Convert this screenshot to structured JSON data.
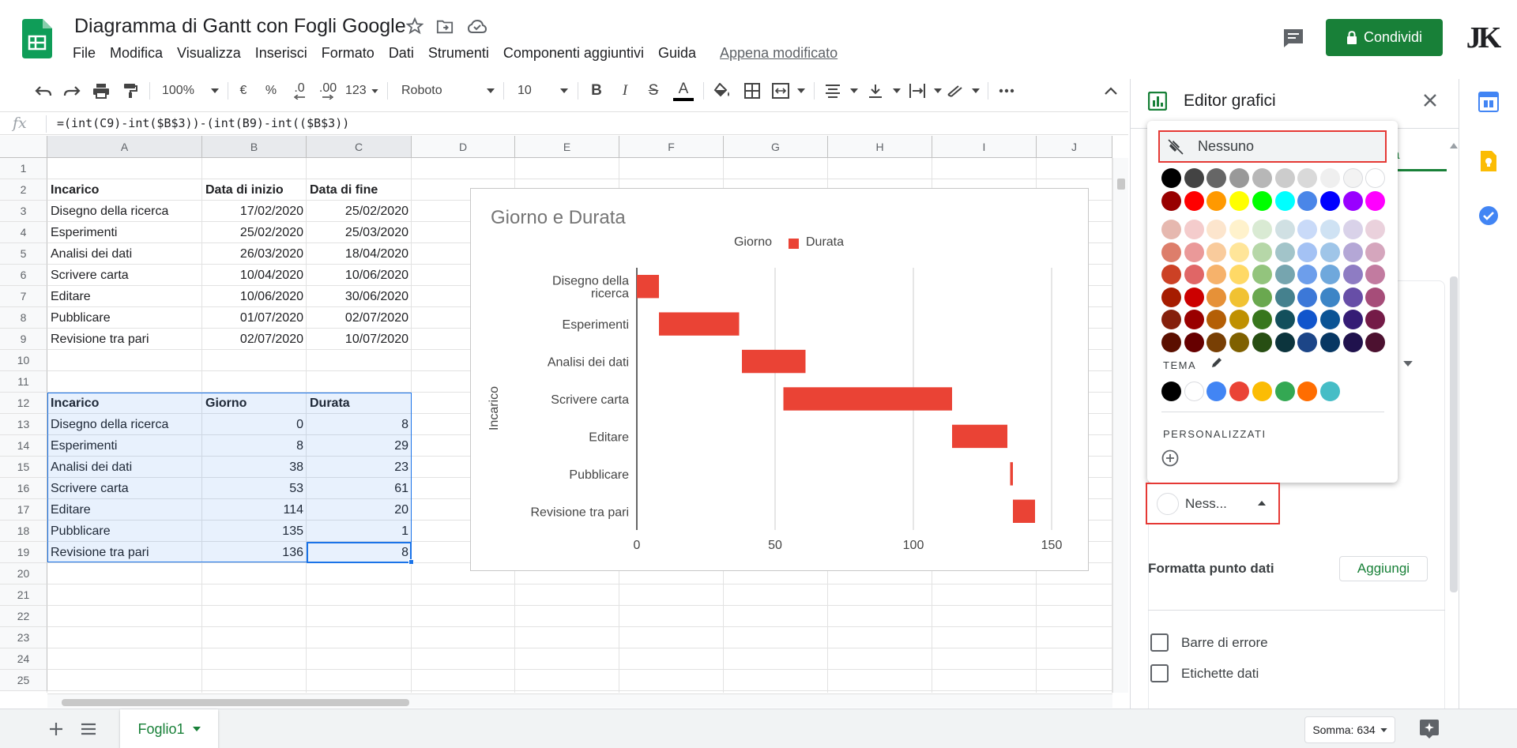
{
  "header": {
    "doc_title": "Diagramma di Gantt con Fogli Google",
    "menu": [
      "File",
      "Modifica",
      "Visualizza",
      "Inserisci",
      "Formato",
      "Dati",
      "Strumenti",
      "Componenti aggiuntivi",
      "Guida"
    ],
    "last_edit": "Appena modificato",
    "share_label": "Condividi",
    "avatar_label": "JK"
  },
  "toolbar": {
    "zoom": "100%",
    "currency": "€",
    "percent": "%",
    "dec_less": ".0",
    "dec_more": ".00",
    "format_more": "123",
    "font": "Roboto",
    "font_size": "10",
    "bold": "B",
    "italic": "I",
    "strike": "S",
    "textcolor": "A"
  },
  "formula_bar": {
    "fx": "fx",
    "formula": "=(int(C9)-int($B$3))-(int(B9)-int(($B$3))"
  },
  "grid": {
    "columns": [
      "A",
      "B",
      "C",
      "D",
      "E",
      "F",
      "G",
      "H",
      "I",
      "J"
    ],
    "rows": [
      "1",
      "2",
      "3",
      "4",
      "5",
      "6",
      "7",
      "8",
      "9",
      "10",
      "11",
      "12",
      "13",
      "14",
      "15",
      "16",
      "17",
      "18",
      "19",
      "20",
      "21",
      "22",
      "23",
      "24",
      "25"
    ],
    "table1": {
      "headers": [
        "Incarico",
        "Data di inizio",
        "Data di fine"
      ],
      "rows": [
        [
          "Disegno della ricerca",
          "17/02/2020",
          "25/02/2020"
        ],
        [
          "Esperimenti",
          "25/02/2020",
          "25/03/2020"
        ],
        [
          "Analisi dei dati",
          "26/03/2020",
          "18/04/2020"
        ],
        [
          "Scrivere carta",
          "10/04/2020",
          "10/06/2020"
        ],
        [
          "Editare",
          "10/06/2020",
          "30/06/2020"
        ],
        [
          "Pubblicare",
          "01/07/2020",
          "02/07/2020"
        ],
        [
          "Revisione tra pari",
          "02/07/2020",
          "10/07/2020"
        ]
      ]
    },
    "table2": {
      "headers": [
        "Incarico",
        "Giorno",
        "Durata"
      ],
      "rows": [
        [
          "Disegno della ricerca",
          "0",
          "8"
        ],
        [
          "Esperimenti",
          "8",
          "29"
        ],
        [
          "Analisi dei dati",
          "38",
          "23"
        ],
        [
          "Scrivere carta",
          "53",
          "61"
        ],
        [
          "Editare",
          "114",
          "20"
        ],
        [
          "Pubblicare",
          "135",
          "1"
        ],
        [
          "Revisione tra pari",
          "136",
          "8"
        ]
      ]
    }
  },
  "chart_data": {
    "type": "bar",
    "orientation": "horizontal",
    "stacked": true,
    "title": "Giorno e Durata",
    "ylabel": "Incarico",
    "categories": [
      "Disegno della ricerca",
      "Esperimenti",
      "Analisi dei dati",
      "Scrivere carta",
      "Editare",
      "Pubblicare",
      "Revisione tra pari"
    ],
    "category_lines": [
      [
        "Disegno della",
        "ricerca"
      ],
      [
        "Esperimenti"
      ],
      [
        "Analisi dei dati"
      ],
      [
        "Scrivere carta"
      ],
      [
        "Editare"
      ],
      [
        "Pubblicare"
      ],
      [
        "Revisione tra pari"
      ]
    ],
    "series": [
      {
        "name": "Giorno",
        "values": [
          0,
          8,
          38,
          53,
          114,
          135,
          136
        ],
        "color": "transparent"
      },
      {
        "name": "Durata",
        "values": [
          8,
          29,
          23,
          61,
          20,
          1,
          8
        ],
        "color": "#ea4335"
      }
    ],
    "xlim": [
      0,
      160
    ],
    "xticks": [
      0,
      50,
      100,
      150
    ],
    "grid": true,
    "legend": "top"
  },
  "panel": {
    "title": "Editor grafici",
    "tab_fragment": "zza",
    "color_picker": {
      "none_label": "Nessuno",
      "grayscale": [
        "#000000",
        "#434343",
        "#666666",
        "#999999",
        "#b7b7b7",
        "#cccccc",
        "#d9d9d9",
        "#efefef",
        "#f3f3f3",
        "#ffffff"
      ],
      "brights": [
        "#980000",
        "#ff0000",
        "#ff9900",
        "#ffff00",
        "#00ff00",
        "#00ffff",
        "#4a86e8",
        "#0000ff",
        "#9900ff",
        "#ff00ff"
      ],
      "shades": [
        [
          "#e6b8af",
          "#f4cccc",
          "#fce5cd",
          "#fff2cc",
          "#d9ead3",
          "#d0e0e3",
          "#c9daf8",
          "#cfe2f3",
          "#d9d2e9",
          "#ead1dc"
        ],
        [
          "#dd7e6b",
          "#ea9999",
          "#f9cb9c",
          "#ffe599",
          "#b6d7a8",
          "#a2c4c9",
          "#a4c2f4",
          "#9fc5e8",
          "#b4a7d6",
          "#d5a6bd"
        ],
        [
          "#cc4125",
          "#e06666",
          "#f6b26b",
          "#ffd966",
          "#93c47d",
          "#76a5af",
          "#6d9eeb",
          "#6fa8dc",
          "#8e7cc3",
          "#c27ba0"
        ],
        [
          "#a61c00",
          "#cc0000",
          "#e69138",
          "#f1c232",
          "#6aa84f",
          "#45818e",
          "#3c78d8",
          "#3d85c6",
          "#674ea7",
          "#a64d79"
        ],
        [
          "#85200c",
          "#990000",
          "#b45f06",
          "#bf9000",
          "#38761d",
          "#134f5c",
          "#1155cc",
          "#0b5394",
          "#351c75",
          "#741b47"
        ],
        [
          "#5b0f00",
          "#660000",
          "#783f04",
          "#7f6000",
          "#274e13",
          "#0c343d",
          "#1c4587",
          "#073763",
          "#20124d",
          "#4c1130"
        ]
      ],
      "theme_label": "TEMA",
      "theme_colors": [
        "#000000",
        "#ffffff",
        "#4285f4",
        "#ea4335",
        "#fbbc04",
        "#34a853",
        "#ff6d01",
        "#46bdc6"
      ],
      "custom_label": "PERSONALIZZATI"
    },
    "color_dropdown_label": "Ness...",
    "format_point_label": "Formatta punto dati",
    "add_label": "Aggiungi",
    "error_bars_label": "Barre di errore",
    "data_labels_label": "Etichette dati"
  },
  "bottom": {
    "sheet_tab": "Foglio1",
    "sum": "Somma: 634"
  }
}
